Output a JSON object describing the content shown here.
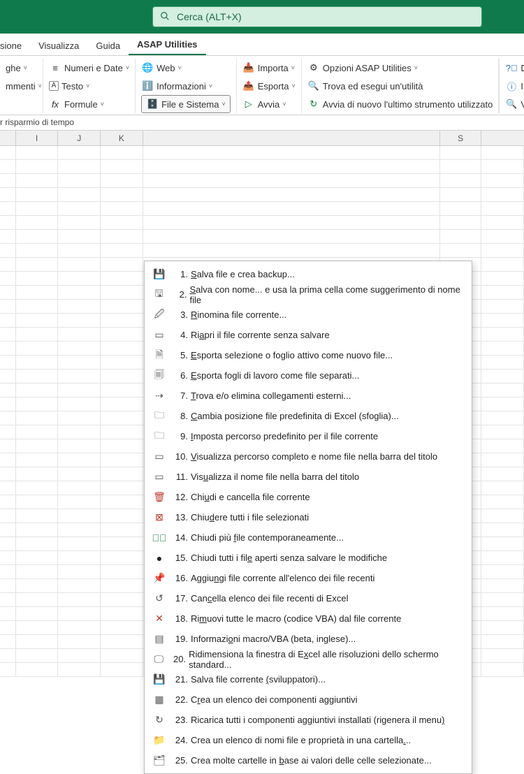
{
  "search": {
    "placeholder": "Cerca (ALT+X)"
  },
  "tabs": {
    "t0": "sione",
    "t1": "Visualizza",
    "t2": "Guida",
    "t3": "ASAP Utilities"
  },
  "ribbon": {
    "g1a": "ghe",
    "g1b": "mmenti",
    "g2a": "Numeri e Date",
    "g2b": "Testo",
    "g2c": "Formule",
    "g3a": "Web",
    "g3b": "Informazioni",
    "g3c": "File e Sistema",
    "g4a": "Importa",
    "g4b": "Esporta",
    "g4c": "Avvia",
    "g5a": "Opzioni ASAP Utilities",
    "g5b": "Trova ed esegui un'utilità",
    "g5c": "Avvia di nuovo l'ultimo strumento utilizzato",
    "g6a": "Do",
    "g6b": "In",
    "g6c": "Ve"
  },
  "caption": "r risparmio di tempo",
  "cols": {
    "i": "I",
    "j": "J",
    "k": "K",
    "s": "S"
  },
  "menu": {
    "m1": {
      "n": "1.",
      "pre": "",
      "u": "S",
      "post": "alva file e crea backup..."
    },
    "m2": {
      "n": "2.",
      "pre": "",
      "u": "S",
      "post": "alva con nome... e usa la prima cella come suggerimento di nome file"
    },
    "m3": {
      "n": "3.",
      "pre": "",
      "u": "R",
      "post": "inomina file corrente..."
    },
    "m4": {
      "n": "4.",
      "pre": "Ri",
      "u": "a",
      "post": "pri il file corrente senza salvare"
    },
    "m5": {
      "n": "5.",
      "pre": "",
      "u": "E",
      "post": "sporta selezione o foglio attivo come nuovo file..."
    },
    "m6": {
      "n": "6.",
      "pre": "",
      "u": "E",
      "post": "sporta fogli di lavoro come file separati..."
    },
    "m7": {
      "n": "7.",
      "pre": "",
      "u": "T",
      "post": "rova e/o elimina collegamenti esterni..."
    },
    "m8": {
      "n": "8.",
      "pre": "",
      "u": "C",
      "post": "ambia posizione file predefinita di Excel (sfoglia)..."
    },
    "m9": {
      "n": "9.",
      "pre": "",
      "u": "I",
      "post": "mposta percorso predefinito per il file corrente"
    },
    "m10": {
      "n": "10.",
      "pre": "",
      "u": "V",
      "post": "isualizza percorso completo e nome file nella barra del titolo"
    },
    "m11": {
      "n": "11.",
      "pre": "Vis",
      "u": "u",
      "post": "alizza il nome file nella barra del titolo"
    },
    "m12": {
      "n": "12.",
      "pre": "Chi",
      "u": "u",
      "post": "di e cancella file corrente"
    },
    "m13": {
      "n": "13.",
      "pre": "Chiu",
      "u": "d",
      "post": "ere tutti i file selezionati"
    },
    "m14": {
      "n": "14.",
      "pre": "Chiudi più ",
      "u": "f",
      "post": "ile contemporaneamente..."
    },
    "m15": {
      "n": "15.",
      "pre": "Chiudi tutti i fil",
      "u": "e",
      "post": " aperti senza salvare le modifiche"
    },
    "m16": {
      "n": "16.",
      "pre": "Aggiu",
      "u": "n",
      "post": "gi file corrente all'elenco dei file recenti"
    },
    "m17": {
      "n": "17.",
      "pre": "Can",
      "u": "c",
      "post": "ella elenco dei file recenti di Excel"
    },
    "m18": {
      "n": "18.",
      "pre": "Ri",
      "u": "m",
      "post": "uovi tutte le macro (codice VBA) dal file corrente"
    },
    "m19": {
      "n": "19.",
      "pre": "Informazi",
      "u": "o",
      "post": "ni macro/VBA (beta, inglese)..."
    },
    "m20": {
      "n": "20.",
      "pre": "Ridimensiona la finestra di E",
      "u": "x",
      "post": "cel alle risoluzioni dello schermo standard..."
    },
    "m21": {
      "n": "21.",
      "pre": "Salva file corrente ",
      "u": "(",
      "post": "sviluppatori)..."
    },
    "m22": {
      "n": "22.",
      "pre": "C",
      "u": "r",
      "post": "ea un elenco dei componenti aggiuntivi"
    },
    "m23": {
      "n": "23.",
      "pre": "Ricarica tutti i componenti aggiuntivi installati (rigenera il menu",
      "u": ")",
      "post": ""
    },
    "m24": {
      "n": "24.",
      "pre": "Crea un elenco di nomi file e proprietà in una cartella",
      "u": ".",
      "post": ".."
    },
    "m25": {
      "n": "25.",
      "pre": "Crea molte cartelle in ",
      "u": "b",
      "post": "ase ai valori delle celle selezionate..."
    }
  }
}
